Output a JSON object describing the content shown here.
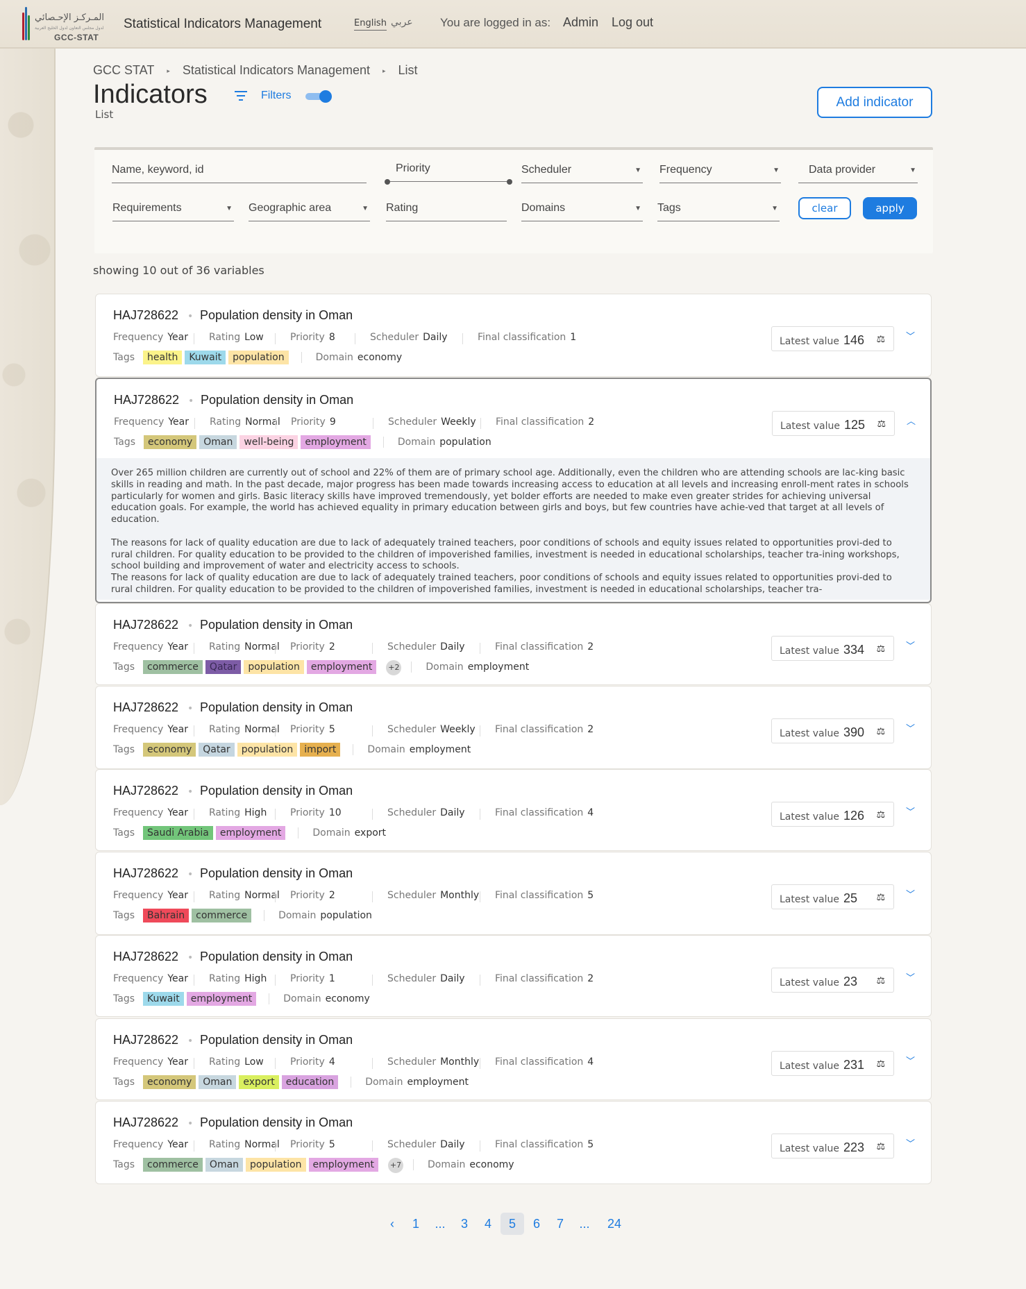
{
  "header": {
    "logo_ar": "المـركـز الإحـصائي",
    "logo_ar_sub": "لدول مجلس التعاون لدول الخليج العربية",
    "logo_en": "GCC-STAT",
    "app_title": "Statistical Indicators Management",
    "lang_en": "English",
    "lang_ar": "عربي",
    "login_text": "You are logged in as:",
    "user": "Admin",
    "logout": "Log out"
  },
  "breadcrumb": [
    "GCC STAT",
    "Statistical Indicators Management",
    "List"
  ],
  "page": {
    "title": "Indicators",
    "subtitle": "List",
    "filters_label": "Filters",
    "add_button": "Add indicator",
    "filters_toggle_on": true
  },
  "filters": {
    "search_placeholder": "Name, keyword, id",
    "priority": "Priority",
    "scheduler": "Scheduler",
    "frequency": "Frequency",
    "data_provider": "Data provider",
    "requirements": "Requirements",
    "geographic_area": "Geographic area",
    "rating": "Rating",
    "domains": "Domains",
    "tags": "Tags",
    "clear": "clear",
    "apply": "apply"
  },
  "showing": "showing 10 out of 36 variables",
  "labels": {
    "frequency": "Frequency",
    "rating": "Rating",
    "priority": "Priority",
    "scheduler": "Scheduler",
    "final_classification": "Final classification",
    "tags": "Tags",
    "domain": "Domain",
    "latest_value": "Latest value"
  },
  "tag_colors": {
    "health": "#fbf38a",
    "Kuwait": "#9dd9eb",
    "population": "#fde4a6",
    "economy": "#d4c77a",
    "Oman": "#c7d7df",
    "well-being": "#fbd3e3",
    "employment": "#e3a8e3",
    "commerce": "#9fc0a2",
    "Qatar": "#7d5ca6",
    "Qatar2": "#c5d6e0",
    "import": "#e6b04f",
    "Saudi Arabia": "#72c57a",
    "Bahrain": "#ef4a5a",
    "export": "#d9ef5f",
    "education": "#d9a3e0"
  },
  "indicators": [
    {
      "id": "HAJ728622",
      "name": "Population density in Oman",
      "frequency": "Year",
      "rating": "Low",
      "priority": "8",
      "scheduler": "Daily",
      "final_classification": "1",
      "tags": [
        "health",
        "Kuwait",
        "population"
      ],
      "more": "",
      "domain": "economy",
      "latest": "146",
      "expanded": false
    },
    {
      "id": "HAJ728622",
      "name": "Population density in Oman",
      "frequency": "Year",
      "rating": "Normal",
      "priority": "9",
      "scheduler": "Weekly",
      "final_classification": "2",
      "tags": [
        "economy",
        "Oman",
        "well-being",
        "employment"
      ],
      "more": "",
      "domain": "population",
      "latest": "125",
      "expanded": true,
      "description": [
        "Over 265 million children are currently out of school and 22% of them are of primary school age. Additionally, even the children who are attending schools are lac-king basic skills in reading and math. In the past decade, major progress has been made towards increasing access to education at all levels and increasing enroll-ment rates in schools particularly for women and girls. Basic literacy skills have improved tremendously, yet bolder efforts are needed to make even greater strides for achieving universal education goals. For example, the world has achieved equality in primary education between girls and boys, but few countries have achie-ved that target at all levels of education.",
        "The reasons for lack of quality education are due to lack of adequately trained teachers, poor conditions of schools and equity issues related to opportunities provi-ded to rural children. For quality education to be provided to the children of impoverished families, investment is needed in educational scholarships, teacher tra-ining workshops, school building and improvement of water and electricity access to schools.",
        "The reasons for lack of quality education are due to lack of adequately trained teachers, poor conditions of schools and equity issues related to opportunities provi-ded to rural children. For quality education to be provided to the children of impoverished families, investment is needed in educational scholarships, teacher tra-"
      ]
    },
    {
      "id": "HAJ728622",
      "name": "Population density in Oman",
      "frequency": "Year",
      "rating": "Normal",
      "priority": "2",
      "scheduler": "Daily",
      "final_classification": "2",
      "tags": [
        "commerce",
        "Qatar",
        "population",
        "employment"
      ],
      "more": "+2",
      "domain": "employment",
      "latest": "334",
      "expanded": false
    },
    {
      "id": "HAJ728622",
      "name": "Population density in Oman",
      "frequency": "Year",
      "rating": "Normal",
      "priority": "5",
      "scheduler": "Weekly",
      "final_classification": "2",
      "tags": [
        "economy",
        "Qatar2",
        "population",
        "import"
      ],
      "more": "",
      "domain": "employment",
      "latest": "390",
      "expanded": false
    },
    {
      "id": "HAJ728622",
      "name": "Population density in Oman",
      "frequency": "Year",
      "rating": "High",
      "priority": "10",
      "scheduler": "Daily",
      "final_classification": "4",
      "tags": [
        "Saudi Arabia",
        "employment"
      ],
      "more": "",
      "domain": "export",
      "latest": "126",
      "expanded": false
    },
    {
      "id": "HAJ728622",
      "name": "Population density in Oman",
      "frequency": "Year",
      "rating": "Normal",
      "priority": "2",
      "scheduler": "Monthly",
      "final_classification": "5",
      "tags": [
        "Bahrain",
        "commerce"
      ],
      "more": "",
      "domain": "population",
      "latest": "25",
      "expanded": false
    },
    {
      "id": "HAJ728622",
      "name": "Population density in Oman",
      "frequency": "Year",
      "rating": "High",
      "priority": "1",
      "scheduler": "Daily",
      "final_classification": "2",
      "tags": [
        "Kuwait",
        "employment"
      ],
      "more": "",
      "domain": "economy",
      "latest": "23",
      "expanded": false
    },
    {
      "id": "HAJ728622",
      "name": "Population density in Oman",
      "frequency": "Year",
      "rating": "Low",
      "priority": "4",
      "scheduler": "Monthly",
      "final_classification": "4",
      "tags": [
        "economy",
        "Oman",
        "export",
        "education"
      ],
      "more": "",
      "domain": "employment",
      "latest": "231",
      "expanded": false
    },
    {
      "id": "HAJ728622",
      "name": "Population density in Oman",
      "frequency": "Year",
      "rating": "Normal",
      "priority": "5",
      "scheduler": "Daily",
      "final_classification": "5",
      "tags": [
        "commerce",
        "Oman",
        "population",
        "employment"
      ],
      "more": "+7",
      "domain": "economy",
      "latest": "223",
      "expanded": false
    }
  ],
  "pagination": {
    "prev": "‹",
    "pages": [
      "1",
      "...",
      "3",
      "4",
      "5",
      "6",
      "7",
      "...",
      "24"
    ],
    "current": "5"
  }
}
